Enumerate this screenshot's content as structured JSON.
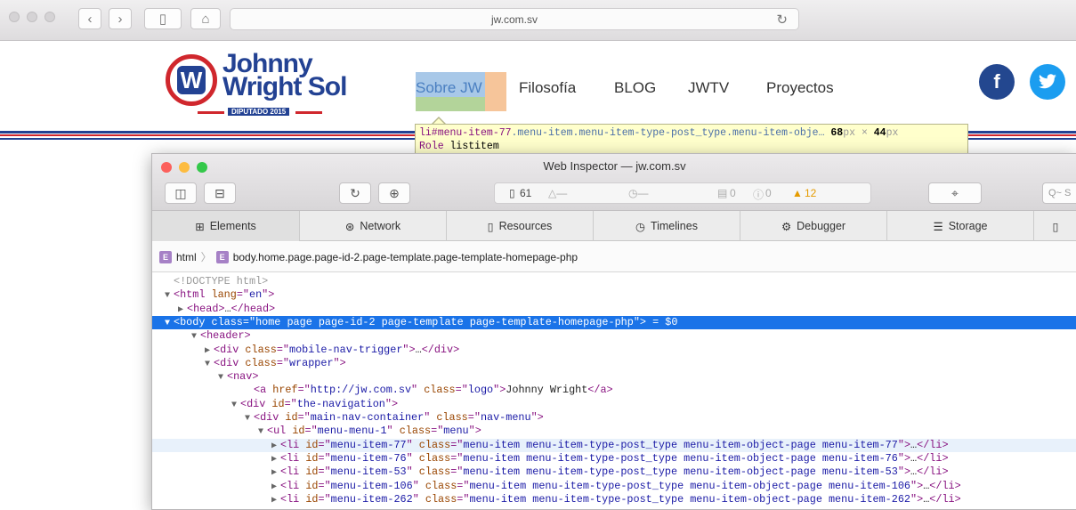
{
  "browser": {
    "url": "jw.com.sv",
    "back_icon": "chevron-left-icon",
    "forward_icon": "chevron-right-icon",
    "sidebar_icon": "sidebar-icon",
    "home_icon": "home-icon",
    "reload_icon": "reload-icon"
  },
  "site": {
    "logo_line1": "Johnny",
    "logo_line2": "Wright Sol",
    "logo_sub": "DIPUTADO 2015",
    "nav": [
      "Sobre JW",
      "Filosofía",
      "BLOG",
      "JWTV",
      "Proyectos"
    ],
    "social": [
      "f",
      "t"
    ],
    "colors": {
      "brand_blue": "#234293",
      "brand_red": "#d0272d",
      "facebook": "#23478f",
      "twitter": "#1b9df0"
    }
  },
  "tooltip": {
    "selector": "li#menu-item-77",
    "classes": ".menu-item.menu-item-type-post_type.menu-item-obje…",
    "width": "68",
    "height": "44",
    "px": "px",
    "times": "×",
    "role_label": "Role",
    "role_value": "listitem"
  },
  "inspector": {
    "title": "Web Inspector — jw.com.sv",
    "resources_count": "61",
    "logs_count": "0",
    "errors_count": "0",
    "warnings_count": "12",
    "search_placeholder": "Q~ S",
    "tabs": [
      "Elements",
      "Network",
      "Resources",
      "Timelines",
      "Debugger",
      "Storage"
    ],
    "breadcrumbs": [
      "html",
      "body.home.page.page-id-2.page-template.page-template-homepage-php"
    ],
    "dom_lines": [
      {
        "indent": 0,
        "tw": "",
        "parts": [
          [
            "cmt",
            "<!DOCTYPE html>"
          ]
        ]
      },
      {
        "indent": 0,
        "tw": "▼",
        "parts": [
          [
            "tag",
            "<html "
          ],
          [
            "attr",
            "lang"
          ],
          [
            "tag",
            "=\""
          ],
          [
            "val",
            "en"
          ],
          [
            "tag",
            "\">"
          ]
        ]
      },
      {
        "indent": 1,
        "tw": "▶",
        "parts": [
          [
            "tag",
            "<head>"
          ],
          [
            "txt",
            "…"
          ],
          [
            "tag",
            "</head>"
          ]
        ]
      },
      {
        "indent": 0,
        "tw": "▼",
        "selected": true,
        "parts": [
          [
            "tag",
            "<body "
          ],
          [
            "attr",
            "class"
          ],
          [
            "tag",
            "=\""
          ],
          [
            "val",
            "home page page-id-2 page-template page-template-homepage-php"
          ],
          [
            "tag",
            "\">"
          ],
          [
            "txt",
            " = $0"
          ]
        ]
      },
      {
        "indent": 2,
        "tw": "▼",
        "parts": [
          [
            "tag",
            "<header>"
          ]
        ]
      },
      {
        "indent": 3,
        "tw": "▶",
        "parts": [
          [
            "tag",
            "<div "
          ],
          [
            "attr",
            "class"
          ],
          [
            "tag",
            "=\""
          ],
          [
            "val",
            "mobile-nav-trigger"
          ],
          [
            "tag",
            "\">"
          ],
          [
            "txt",
            "…"
          ],
          [
            "tag",
            "</div>"
          ]
        ]
      },
      {
        "indent": 3,
        "tw": "▼",
        "parts": [
          [
            "tag",
            "<div "
          ],
          [
            "attr",
            "class"
          ],
          [
            "tag",
            "=\""
          ],
          [
            "val",
            "wrapper"
          ],
          [
            "tag",
            "\">"
          ]
        ]
      },
      {
        "indent": 4,
        "tw": "▼",
        "parts": [
          [
            "tag",
            "<nav>"
          ]
        ]
      },
      {
        "indent": 6,
        "tw": "",
        "parts": [
          [
            "tag",
            "<a "
          ],
          [
            "attr",
            "href"
          ],
          [
            "tag",
            "=\""
          ],
          [
            "val",
            "http://jw.com.sv"
          ],
          [
            "tag",
            "\" "
          ],
          [
            "attr",
            "class"
          ],
          [
            "tag",
            "=\""
          ],
          [
            "val",
            "logo"
          ],
          [
            "tag",
            "\">"
          ],
          [
            "txt",
            "Johnny Wright"
          ],
          [
            "tag",
            "</a>"
          ]
        ]
      },
      {
        "indent": 5,
        "tw": "▼",
        "parts": [
          [
            "tag",
            "<div "
          ],
          [
            "attr",
            "id"
          ],
          [
            "tag",
            "=\""
          ],
          [
            "val",
            "the-navigation"
          ],
          [
            "tag",
            "\">"
          ]
        ]
      },
      {
        "indent": 6,
        "tw": "▼",
        "parts": [
          [
            "tag",
            "<div "
          ],
          [
            "attr",
            "id"
          ],
          [
            "tag",
            "=\""
          ],
          [
            "val",
            "main-nav-container"
          ],
          [
            "tag",
            "\" "
          ],
          [
            "attr",
            "class"
          ],
          [
            "tag",
            "=\""
          ],
          [
            "val",
            "nav-menu"
          ],
          [
            "tag",
            "\">"
          ]
        ]
      },
      {
        "indent": 7,
        "tw": "▼",
        "parts": [
          [
            "tag",
            "<ul "
          ],
          [
            "attr",
            "id"
          ],
          [
            "tag",
            "=\""
          ],
          [
            "val",
            "menu-menu-1"
          ],
          [
            "tag",
            "\" "
          ],
          [
            "attr",
            "class"
          ],
          [
            "tag",
            "=\""
          ],
          [
            "val",
            "menu"
          ],
          [
            "tag",
            "\">"
          ]
        ]
      },
      {
        "indent": 8,
        "tw": "▶",
        "hovered": true,
        "parts": [
          [
            "tag",
            "<li "
          ],
          [
            "attr",
            "id"
          ],
          [
            "tag",
            "=\""
          ],
          [
            "val",
            "menu-item-77"
          ],
          [
            "tag",
            "\" "
          ],
          [
            "attr",
            "class"
          ],
          [
            "tag",
            "=\""
          ],
          [
            "val",
            "menu-item menu-item-type-post_type menu-item-object-page menu-item-77"
          ],
          [
            "tag",
            "\">"
          ],
          [
            "txt",
            "…"
          ],
          [
            "tag",
            "</li>"
          ]
        ]
      },
      {
        "indent": 8,
        "tw": "▶",
        "parts": [
          [
            "tag",
            "<li "
          ],
          [
            "attr",
            "id"
          ],
          [
            "tag",
            "=\""
          ],
          [
            "val",
            "menu-item-76"
          ],
          [
            "tag",
            "\" "
          ],
          [
            "attr",
            "class"
          ],
          [
            "tag",
            "=\""
          ],
          [
            "val",
            "menu-item menu-item-type-post_type menu-item-object-page menu-item-76"
          ],
          [
            "tag",
            "\">"
          ],
          [
            "txt",
            "…"
          ],
          [
            "tag",
            "</li>"
          ]
        ]
      },
      {
        "indent": 8,
        "tw": "▶",
        "parts": [
          [
            "tag",
            "<li "
          ],
          [
            "attr",
            "id"
          ],
          [
            "tag",
            "=\""
          ],
          [
            "val",
            "menu-item-53"
          ],
          [
            "tag",
            "\" "
          ],
          [
            "attr",
            "class"
          ],
          [
            "tag",
            "=\""
          ],
          [
            "val",
            "menu-item menu-item-type-post_type menu-item-object-page menu-item-53"
          ],
          [
            "tag",
            "\">"
          ],
          [
            "txt",
            "…"
          ],
          [
            "tag",
            "</li>"
          ]
        ]
      },
      {
        "indent": 8,
        "tw": "▶",
        "parts": [
          [
            "tag",
            "<li "
          ],
          [
            "attr",
            "id"
          ],
          [
            "tag",
            "=\""
          ],
          [
            "val",
            "menu-item-106"
          ],
          [
            "tag",
            "\" "
          ],
          [
            "attr",
            "class"
          ],
          [
            "tag",
            "=\""
          ],
          [
            "val",
            "menu-item menu-item-type-post_type menu-item-object-page menu-item-106"
          ],
          [
            "tag",
            "\">"
          ],
          [
            "txt",
            "…"
          ],
          [
            "tag",
            "</li>"
          ]
        ]
      },
      {
        "indent": 8,
        "tw": "▶",
        "parts": [
          [
            "tag",
            "<li "
          ],
          [
            "attr",
            "id"
          ],
          [
            "tag",
            "=\""
          ],
          [
            "val",
            "menu-item-262"
          ],
          [
            "tag",
            "\" "
          ],
          [
            "attr",
            "class"
          ],
          [
            "tag",
            "=\""
          ],
          [
            "val",
            "menu-item menu-item-type-post_type menu-item-object-page menu-item-262"
          ],
          [
            "tag",
            "\">"
          ],
          [
            "txt",
            "…"
          ],
          [
            "tag",
            "</li>"
          ]
        ]
      }
    ]
  }
}
